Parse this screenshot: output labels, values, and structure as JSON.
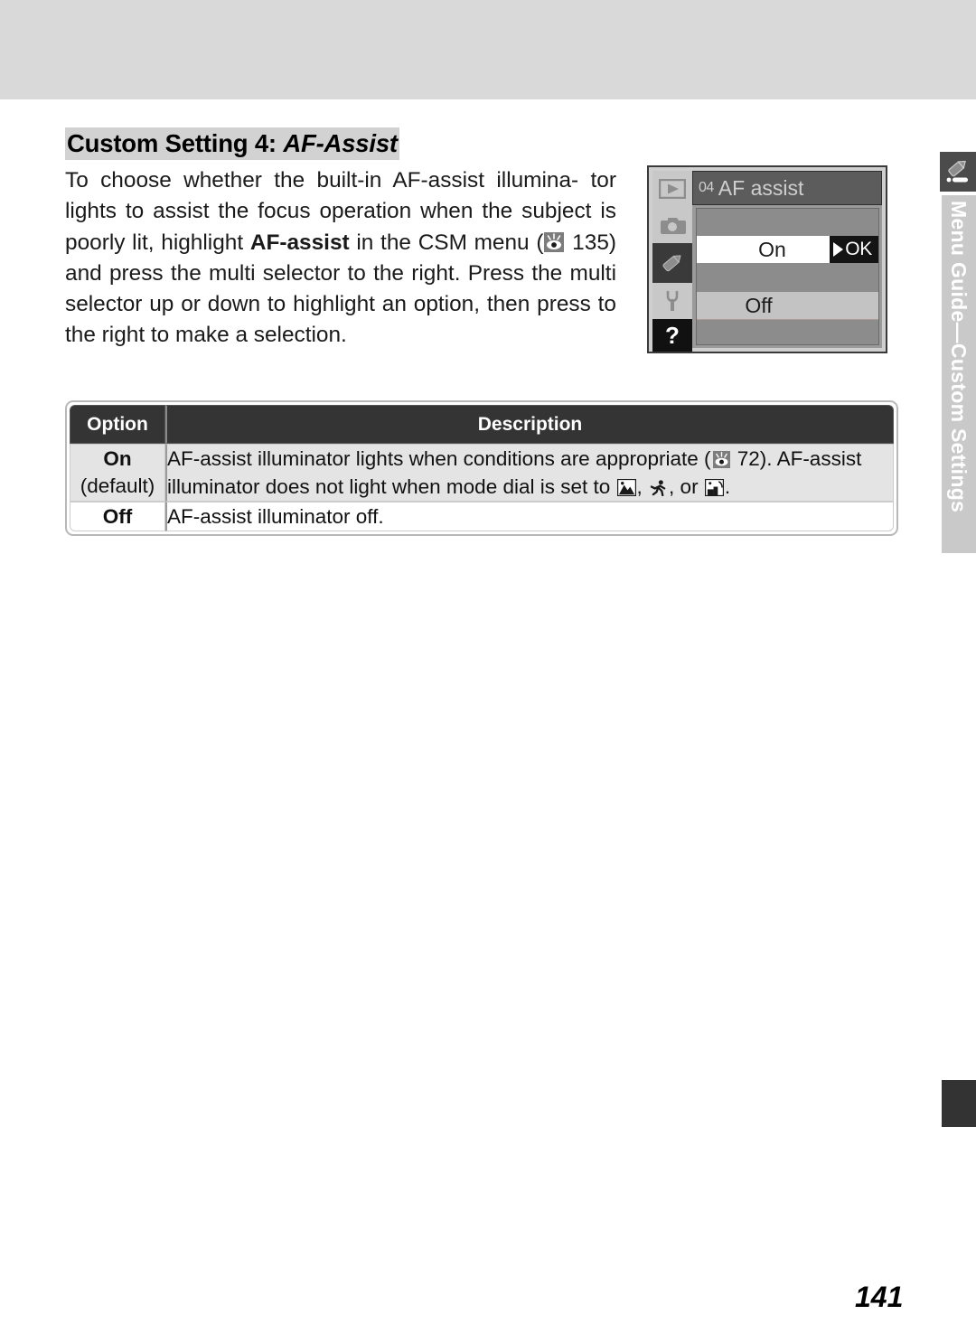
{
  "page": {
    "number": "141",
    "heading_plain": "Custom Setting 4: ",
    "heading_italic": "AF-Assist"
  },
  "body": {
    "line1": "To choose whether the built-in AF-assist illumina-",
    "line2": "tor lights to assist the focus operation when the",
    "line3_a": "subject is poorly lit, highlight ",
    "line3_bold": "AF-assist",
    "line3_b": " in the",
    "line4_a": "CSM menu (",
    "line4_b": " 135) and press the multi selector",
    "line5": "to the right.  Press the multi selector up or down",
    "line6": "to highlight an option, then press to the right to",
    "line7": "make a selection."
  },
  "lcd": {
    "title_number": "04",
    "title_text": "AF assist",
    "rows": [
      {
        "label": "On",
        "badge": "OK",
        "selected": true
      },
      {
        "label": "Off",
        "badge": "",
        "selected": false
      }
    ],
    "rail_icons": [
      "playback-icon",
      "shooting-menu-camera-icon",
      "custom-settings-pencil-icon",
      "setup-wrench-icon",
      "help-question-icon"
    ]
  },
  "table": {
    "headers": {
      "option": "Option",
      "description": "Description"
    },
    "rows": [
      {
        "option": "On",
        "option_sub": "(default)",
        "desc_a": "AF-assist illuminator lights when conditions are appropriate (",
        "desc_b": " 72).  AF-assist illuminator does not light when mode dial is set to ",
        "desc_c": ", ",
        "desc_d": ", or ",
        "desc_e": "."
      },
      {
        "option": "Off",
        "option_sub": "",
        "desc_a": "AF-assist illuminator off.",
        "desc_b": "",
        "desc_c": "",
        "desc_d": "",
        "desc_e": ""
      }
    ]
  },
  "side_tab": {
    "label": "Menu Guide—Custom Settings",
    "icon": "custom-settings-pencil-icon"
  },
  "colors": {
    "top_band": "#d9d9d9",
    "heading_highlight": "#d2d2d2",
    "table_header_bg": "#343434",
    "row_alt_bg": "#e4e4e4",
    "side_tab_bg": "#c9c9c9",
    "lcd_bezel": "#3a3a3a"
  }
}
